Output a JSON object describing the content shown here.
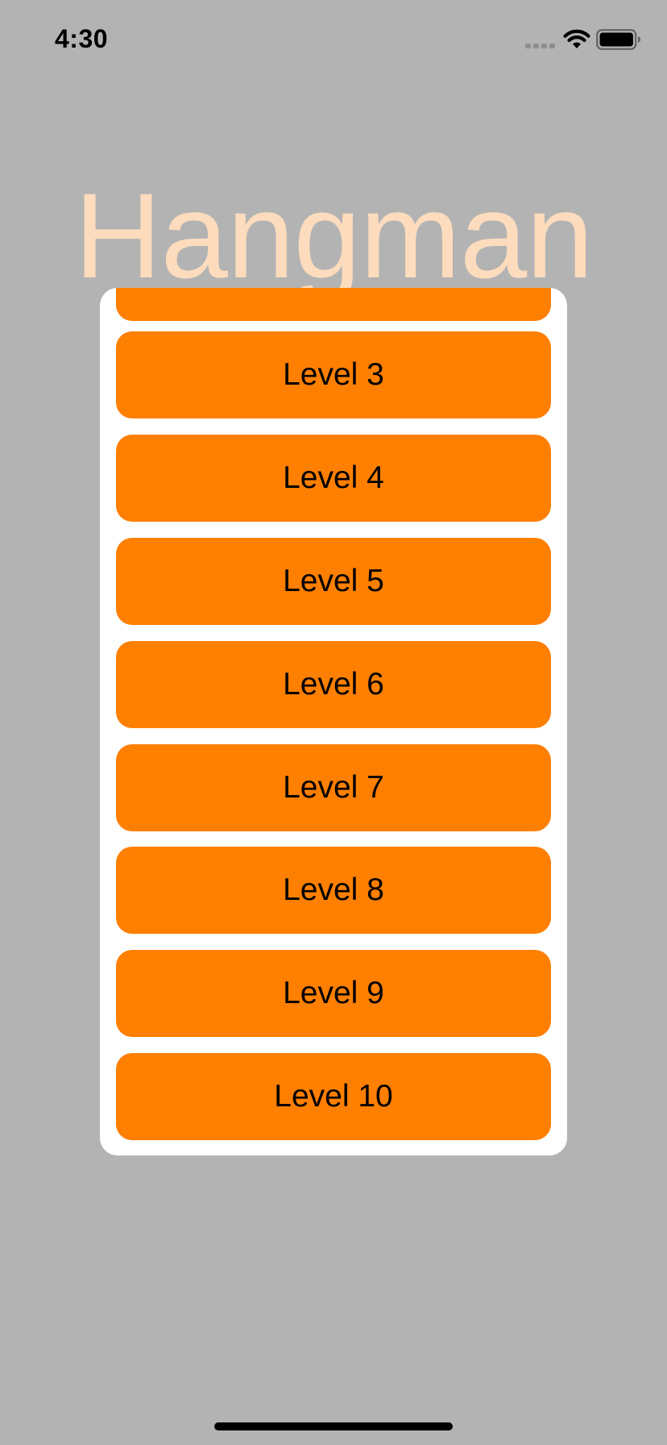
{
  "status_bar": {
    "time": "4:30",
    "icons": [
      "signal-icon",
      "wifi-icon",
      "battery-icon"
    ]
  },
  "title": "Hangman",
  "levels": [
    {
      "label": ""
    },
    {
      "label": "Level 3"
    },
    {
      "label": "Level 4"
    },
    {
      "label": "Level 5"
    },
    {
      "label": "Level 6"
    },
    {
      "label": "Level 7"
    },
    {
      "label": "Level 8"
    },
    {
      "label": "Level 9"
    },
    {
      "label": "Level 10"
    }
  ],
  "colors": {
    "background": "#b3b3b3",
    "title": "#fddcbd",
    "card": "#ffffff",
    "button": "#ff7f00",
    "button_text": "#000000"
  }
}
